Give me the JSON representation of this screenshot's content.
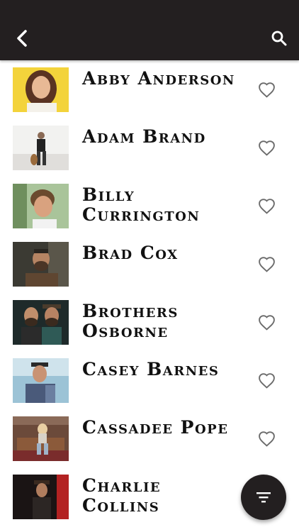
{
  "header": {
    "back_icon": "chevron-left-icon",
    "search_icon": "search-icon",
    "background": "#231f20"
  },
  "artists": [
    {
      "name": "Abby Anderson",
      "favorite": false
    },
    {
      "name": "Adam Brand",
      "favorite": false
    },
    {
      "name": "Billy Currington",
      "favorite": false
    },
    {
      "name": "Brad Cox",
      "favorite": false
    },
    {
      "name": "Brothers Osborne",
      "favorite": false
    },
    {
      "name": "Casey Barnes",
      "favorite": false
    },
    {
      "name": "Cassadee Pope",
      "favorite": false
    },
    {
      "name": "Charlie Collins",
      "favorite": false
    }
  ],
  "fab": {
    "icon": "filter-icon",
    "background": "#231f20"
  }
}
